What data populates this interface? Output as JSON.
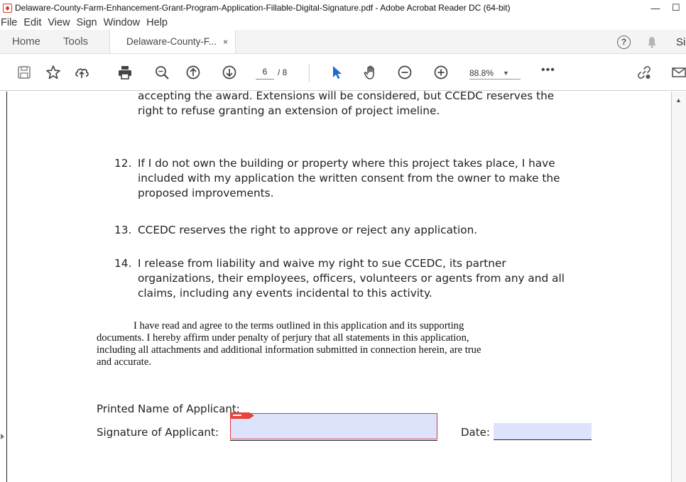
{
  "window": {
    "title": "Delaware-County-Farm-Enhancement-Grant-Program-Application-Fillable-Digital-Signature.pdf - Adobe Acrobat Reader DC (64-bit)",
    "minimize_glyph": "—",
    "restore_glyph": "☐"
  },
  "menu": [
    "File",
    "Edit",
    "View",
    "Sign",
    "Window",
    "Help"
  ],
  "tabs": {
    "home": "Home",
    "tools": "Tools",
    "document": "Delaware-County-F...",
    "close_glyph": "×",
    "help_glyph": "?",
    "sign_partial": "Si"
  },
  "toolbar": {
    "current_page": "6",
    "page_total": "/ 8",
    "zoom": "88.8%",
    "zoom_caret": "▼",
    "more_glyph": "•••"
  },
  "document": {
    "top_line_1": "accepting the award. Extensions will be considered, but CCEDC reserves the",
    "top_line_2": "right to refuse granting an extension of project imeline.",
    "item12_num": "12.",
    "item12_lines": [
      "If I do not own the building or property where this project takes place, I have",
      "included with my application the written consent from the owner to make the",
      "proposed improvements."
    ],
    "item13_num": "13.",
    "item13_text": "CCEDC reserves the right to approve or reject any application.",
    "item14_num": "14.",
    "item14_lines": [
      "I release from liability and waive my right to sue CCEDC, its partner",
      "organizations, their employees, officers, volunteers or agents from any and all",
      "claims, including any events incidental to this activity."
    ],
    "affirm_lines": [
      "I have read and agree to the terms outlined in this application and its supporting",
      "documents. I hereby affirm under penalty of perjury that all statements in this application,",
      "including all attachments and additional information submitted in connection herein, are true",
      "and accurate."
    ],
    "printed_name_label": "Printed Name of Applicant:",
    "signature_label": "Signature of Applicant:",
    "date_label": "Date:"
  },
  "colors": {
    "field_fill": "#dde3fb",
    "signature_border": "#e0323a",
    "acrobat_red": "#d23b2b"
  }
}
